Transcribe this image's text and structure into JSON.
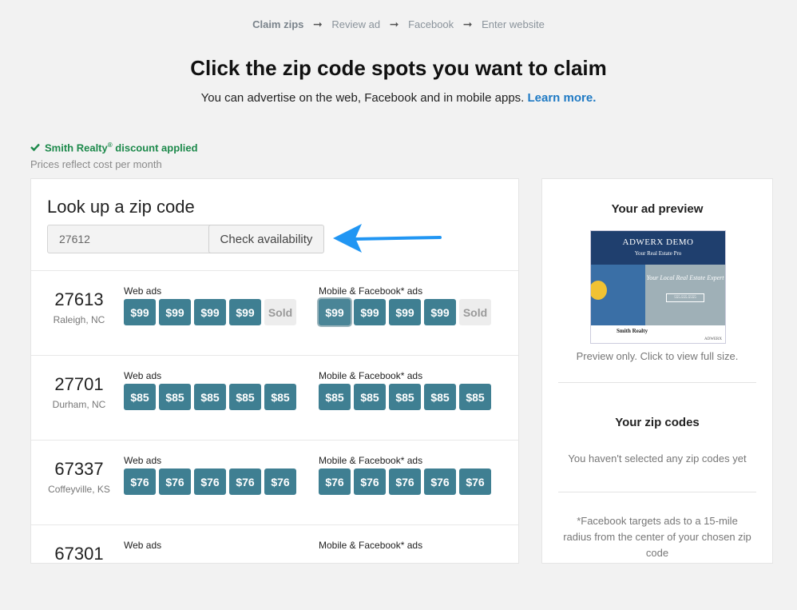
{
  "steps": [
    "Claim zips",
    "Review ad",
    "Facebook",
    "Enter website"
  ],
  "headline": "Click the zip code spots you want to claim",
  "subline": "You can advertise on the web, Facebook and in mobile apps.",
  "learn_more": "Learn more.",
  "discount": {
    "brand": "Smith Realty",
    "reg": "®",
    "text": "discount applied"
  },
  "prices_note": "Prices reflect cost per month",
  "lookup": {
    "title": "Look up a zip code",
    "input_value": "27612",
    "button": "Check availability"
  },
  "group_labels": {
    "web": "Web ads",
    "mobile": "Mobile & Facebook* ads"
  },
  "zips": [
    {
      "code": "27613",
      "city": "Raleigh, NC",
      "web": [
        "$99",
        "$99",
        "$99",
        "$99",
        "Sold"
      ],
      "mobile": [
        "$99",
        "$99",
        "$99",
        "$99",
        "Sold"
      ]
    },
    {
      "code": "27701",
      "city": "Durham, NC",
      "web": [
        "$85",
        "$85",
        "$85",
        "$85",
        "$85"
      ],
      "mobile": [
        "$85",
        "$85",
        "$85",
        "$85",
        "$85"
      ]
    },
    {
      "code": "67337",
      "city": "Coffeyville, KS",
      "web": [
        "$76",
        "$76",
        "$76",
        "$76",
        "$76"
      ],
      "mobile": [
        "$76",
        "$76",
        "$76",
        "$76",
        "$76"
      ]
    },
    {
      "code": "67301",
      "city": "",
      "web": [],
      "mobile": []
    }
  ],
  "preview": {
    "title": "Your ad preview",
    "ad_title": "ADWERX DEMO",
    "ad_subtitle": "Your Real Estate Pro",
    "ad_tagline": "Your Local Real Estate Expert",
    "ad_phone": "555.555.5555",
    "ad_brand": "Smith Realty",
    "ad_footer": "ADWERX",
    "note": "Preview only. Click to view full size."
  },
  "your_zips": {
    "title": "Your zip codes",
    "empty": "You haven't selected any zip codes yet"
  },
  "fb_note": "*Facebook targets ads to a 15-mile radius from the center of your chosen zip code",
  "colors": {
    "price": "#3f7f92",
    "link": "#1f7ac4",
    "discount": "#1e8a4c",
    "arrow": "#2196f3"
  }
}
